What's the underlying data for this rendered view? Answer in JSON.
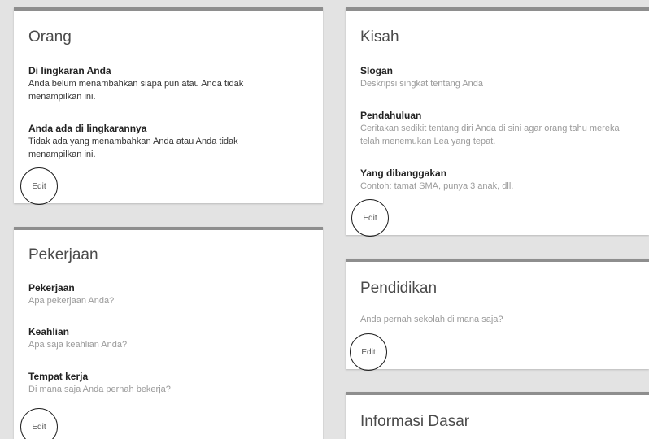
{
  "orang": {
    "title": "Orang",
    "circles_label": "Di lingkaran Anda",
    "circles_value": "Anda belum menambahkan siapa pun atau Anda tidak menampilkan ini.",
    "in_circles_label": "Anda ada di lingkarannya",
    "in_circles_value": "Tidak ada yang menambahkan Anda atau Anda tidak menampilkan ini.",
    "edit": "Edit"
  },
  "pekerjaan": {
    "title": "Pekerjaan",
    "occupation_label": "Pekerjaan",
    "occupation_placeholder": "Apa pekerjaan Anda?",
    "skills_label": "Keahlian",
    "skills_placeholder": "Apa saja keahlian Anda?",
    "workplace_label": "Tempat kerja",
    "workplace_placeholder": "Di mana saja Anda pernah bekerja?",
    "edit": "Edit"
  },
  "kisah": {
    "title": "Kisah",
    "tagline_label": "Slogan",
    "tagline_placeholder": "Deskripsi singkat tentang Anda",
    "intro_label": "Pendahuluan",
    "intro_placeholder": "Ceritakan sedikit tentang diri Anda di sini agar orang tahu mereka telah menemukan Lea yang tepat.",
    "bragging_label": "Yang dibanggakan",
    "bragging_placeholder": "Contoh: tamat SMA, punya 3 anak, dll.",
    "edit": "Edit"
  },
  "pendidikan": {
    "title": "Pendidikan",
    "schools_placeholder": "Anda pernah sekolah di mana saja?",
    "edit": "Edit"
  },
  "informasi": {
    "title": "Informasi Dasar"
  }
}
